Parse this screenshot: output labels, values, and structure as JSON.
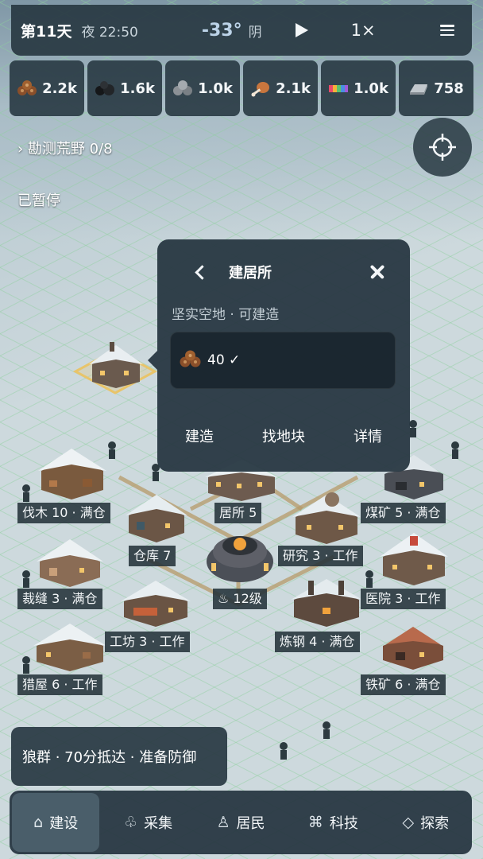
{
  "status": {
    "day": "第11天",
    "time": "夜 22:50",
    "temperature": "-33°",
    "weather": "阴",
    "speed": "1×"
  },
  "resources": [
    {
      "icon": "wood-icon",
      "value": "2.2k"
    },
    {
      "icon": "coal-icon",
      "value": "1.6k"
    },
    {
      "icon": "stone-icon",
      "value": "1.0k"
    },
    {
      "icon": "meat-icon",
      "value": "2.1k"
    },
    {
      "icon": "fabric-icon",
      "value": "1.0k"
    },
    {
      "icon": "steel-ingot-icon",
      "value": "758"
    }
  ],
  "quest": "› 勘测荒野 0/8",
  "paused": "已暂停",
  "popup": {
    "title": "建居所",
    "subtitle": "坚实空地 · 可建造",
    "cost": "40 ✓",
    "actions": {
      "build": "建造",
      "find_plot": "找地块",
      "details": "详情"
    }
  },
  "buildings": [
    {
      "name": "lumber-mill",
      "label": "伐木 10 · 满仓"
    },
    {
      "name": "shelter",
      "label": "居所 5"
    },
    {
      "name": "coal-mine",
      "label": "煤矿 5 · 满仓"
    },
    {
      "name": "warehouse",
      "label": "仓库 7"
    },
    {
      "name": "research",
      "label": "研究 3 · 工作"
    },
    {
      "name": "tailor",
      "label": "裁缝 3 · 满仓"
    },
    {
      "name": "generator",
      "label": "♨ 12级"
    },
    {
      "name": "hospital",
      "label": "医院 3 · 工作"
    },
    {
      "name": "workshop",
      "label": "工坊 3 · 工作"
    },
    {
      "name": "steelworks",
      "label": "炼钢 4 · 满仓"
    },
    {
      "name": "hunters-hut",
      "label": "猎屋 6 · 工作"
    },
    {
      "name": "iron-mine",
      "label": "铁矿 6 · 满仓"
    }
  ],
  "alert": "狼群 · 70分抵达 · 准备防御",
  "nav": [
    {
      "glyph": "⌂",
      "label": "建设",
      "active": true
    },
    {
      "glyph": "♧",
      "label": "采集",
      "active": false
    },
    {
      "glyph": "♙",
      "label": "居民",
      "active": false
    },
    {
      "glyph": "⌘",
      "label": "科技",
      "active": false
    },
    {
      "glyph": "◇",
      "label": "探索",
      "active": false
    }
  ],
  "colors": {
    "panel": "#283842",
    "snow": "#cdd9dd",
    "grid": "#8fd19e",
    "highlight": "#e8c46a"
  }
}
